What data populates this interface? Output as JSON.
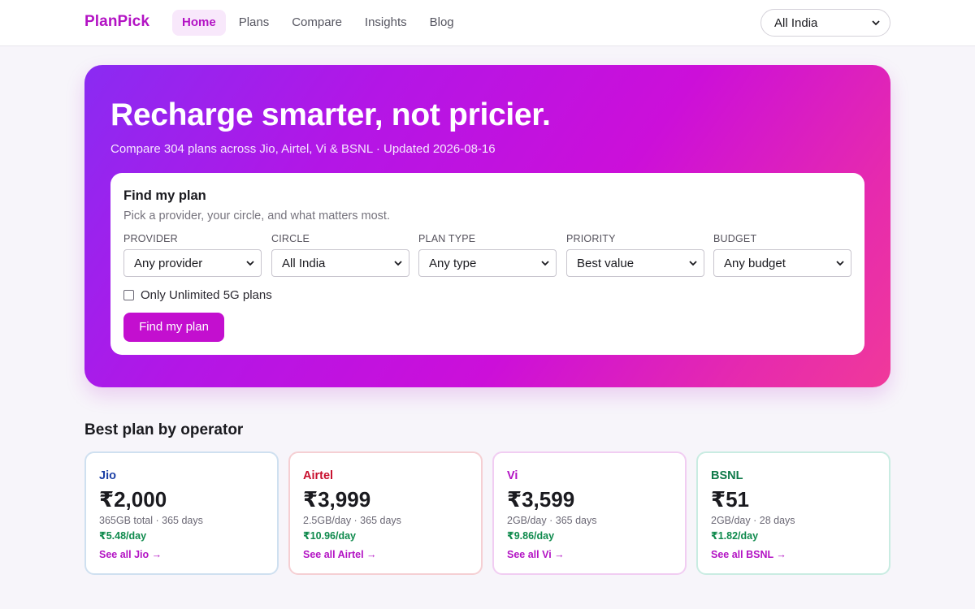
{
  "brand": "PlanPick",
  "nav": [
    {
      "label": "Home",
      "active": true
    },
    {
      "label": "Plans",
      "active": false
    },
    {
      "label": "Compare",
      "active": false
    },
    {
      "label": "Insights",
      "active": false
    },
    {
      "label": "Blog",
      "active": false
    }
  ],
  "region_select": {
    "value": "All India",
    "icon": "chevron-down-icon"
  },
  "hero": {
    "title": "Recharge smarter, not pricier.",
    "subtitle": "Compare 304 plans across Jio, Airtel, Vi & BSNL · Updated 2026-08-16"
  },
  "finder": {
    "title": "Find my plan",
    "subtitle": "Pick a provider, your circle, and what matters most.",
    "fields": [
      {
        "label": "PROVIDER",
        "value": "Any provider"
      },
      {
        "label": "CIRCLE",
        "value": "All India"
      },
      {
        "label": "PLAN TYPE",
        "value": "Any type"
      },
      {
        "label": "PRIORITY",
        "value": "Best value"
      },
      {
        "label": "BUDGET",
        "value": "Any budget"
      }
    ],
    "checkbox_label": "Only Unlimited 5G plans",
    "checkbox_checked": false,
    "button_label": "Find my plan"
  },
  "best_plans": {
    "title": "Best plan by operator",
    "cards": [
      {
        "operator": "Jio",
        "color": "#1b3fa6",
        "price": "₹2,000",
        "meta": "365GB total · 365 days",
        "per_day": "₹5.48/day",
        "link": "See all Jio →"
      },
      {
        "operator": "Airtel",
        "color": "#c8102e",
        "price": "₹3,999",
        "meta": "2.5GB/day · 365 days",
        "per_day": "₹10.96/day",
        "link": "See all Airtel →"
      },
      {
        "operator": "Vi",
        "color": "#b313c4",
        "price": "₹3,599",
        "meta": "2GB/day · 365 days",
        "per_day": "₹9.86/day",
        "link": "See all Vi →"
      },
      {
        "operator": "BSNL",
        "color": "#0f7a4a",
        "price": "₹51",
        "meta": "2GB/day · 28 days",
        "per_day": "₹1.82/day",
        "link": "See all BSNL →"
      }
    ]
  },
  "colors": {
    "accent": "#c30fcf",
    "per_day_green": "#0f8a4d"
  }
}
